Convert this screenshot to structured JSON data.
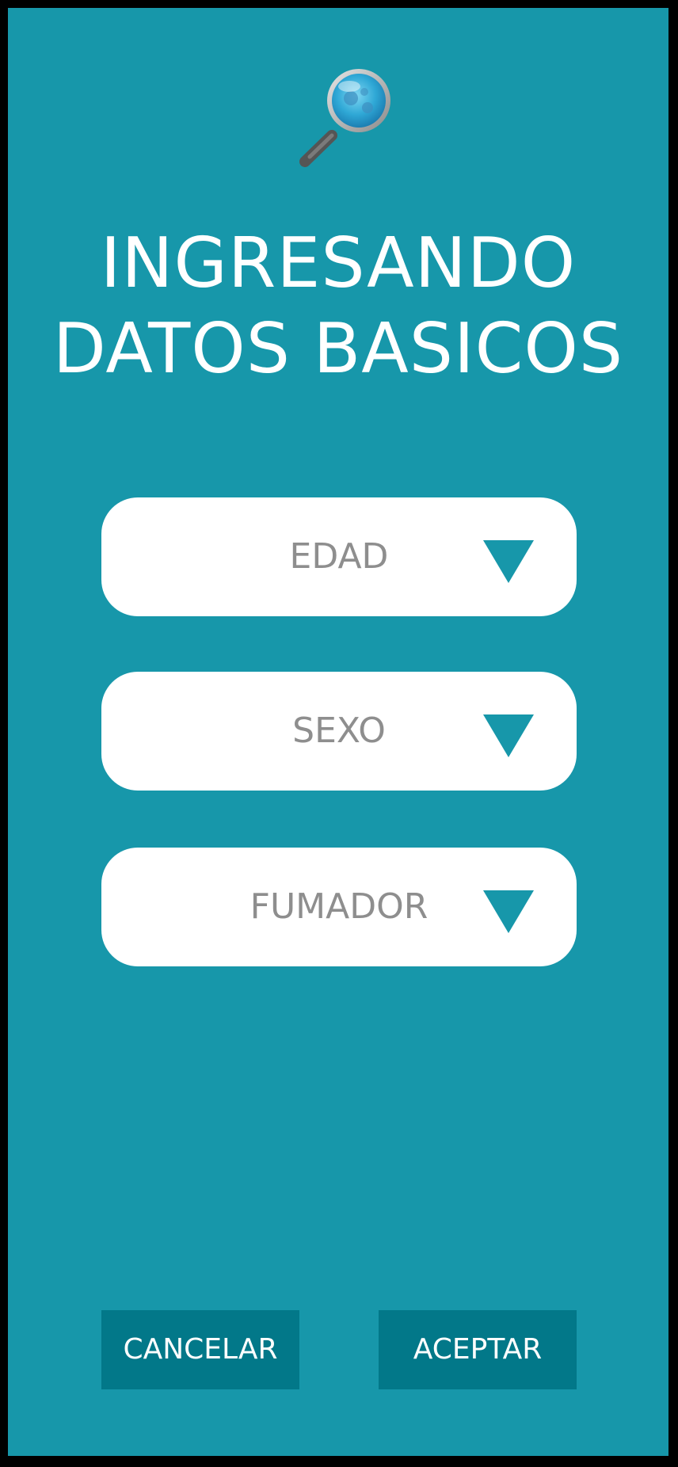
{
  "header": {
    "logo_icon": "magnifying-glass-icon",
    "title_line1": "INGRESANDO",
    "title_line2": "DATOS BASICOS"
  },
  "form": {
    "fields": [
      {
        "label": "EDAD",
        "icon": "triangle-down-icon"
      },
      {
        "label": "SEXO",
        "icon": "triangle-down-icon"
      },
      {
        "label": "FUMADOR",
        "icon": "triangle-down-icon"
      }
    ]
  },
  "actions": {
    "cancel_label": "CANCELAR",
    "accept_label": "ACEPTAR"
  },
  "colors": {
    "background": "#1797aa",
    "button": "#027889",
    "field_background": "#ffffff",
    "field_text": "#8e8e8e",
    "arrow": "#1797aa"
  }
}
